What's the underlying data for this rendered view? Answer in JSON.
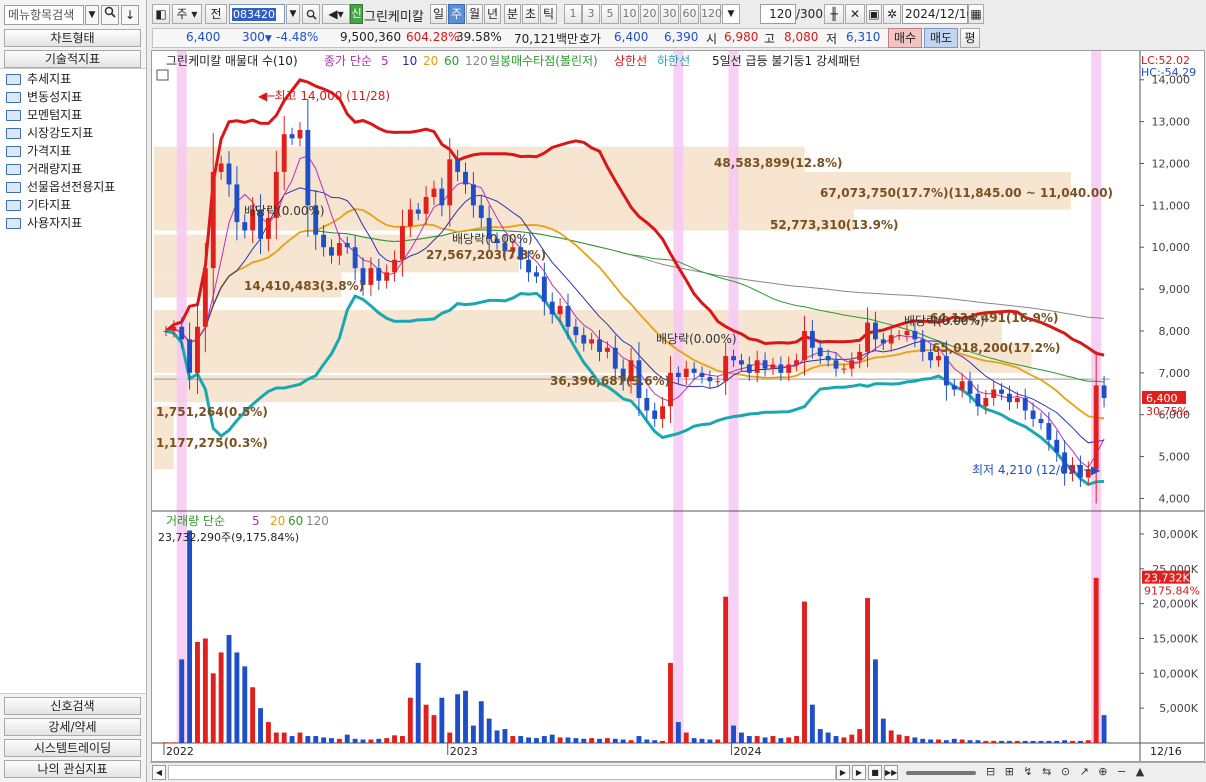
{
  "left_panel": {
    "menu_search_placeholder": "메뉴항목검색",
    "chart_type_label": "차트형태",
    "tech_indicator_label": "기술적지표",
    "tree": [
      "추세지표",
      "변동성지표",
      "모멘텀지표",
      "시장강도지표",
      "가격지표",
      "거래량지표",
      "선물옵션전용지표",
      "기타지표",
      "사용자지표"
    ],
    "bottom_buttons": [
      "신호검색",
      "강세/약세",
      "시스템트레이딩",
      "나의 관심지표"
    ]
  },
  "toolbar": {
    "period_select": "주",
    "prev_label": "전",
    "stock_code": "083420",
    "credit_badge": "신",
    "stock_name": "그린케미칼",
    "period_tabs": [
      "일",
      "주",
      "월",
      "년",
      "분",
      "초",
      "틱"
    ],
    "active_tab": "주",
    "interval_buttons": [
      "1",
      "3",
      "5",
      "10",
      "20",
      "30",
      "60",
      "120"
    ],
    "count_value": "120",
    "count_total": "/300",
    "date": "2024/12/16"
  },
  "quote": {
    "price": "6,400",
    "change": "300",
    "change_pct": "-4.48%",
    "volume": "9,500,360",
    "vol_ratio": "604.28%",
    "turnover": "39.58%",
    "amount": "70,121백만",
    "ask_label": "호가",
    "ask": "6,400",
    "bid": "6,390",
    "open_label": "시",
    "open": "6,980",
    "high_label": "고",
    "high": "8,080",
    "low_label": "저",
    "low": "6,310",
    "buy_label": "매수",
    "sell_label": "매도",
    "eval_label": "평"
  },
  "legend": {
    "title": "그린케미칼 매물대 수(10)",
    "ma_label": "종가 단순",
    "ma_periods": [
      "5",
      "10",
      "20",
      "60",
      "120"
    ],
    "ichimoku": "일봉매수타점(볼린저)",
    "upper": "상한선",
    "lower": "하한선",
    "pattern": "5일선 급등 불기둥1 강세패턴",
    "lc": "LC:52.02",
    "hc": "HC:-54.29"
  },
  "annotations": {
    "high_mark": "최고 14,000 (11/28)",
    "low_mark": "최저 4,210 (12/09)",
    "dividend": "배당락(0.00%)",
    "price_tag": "6,400",
    "price_pct": "30.75%",
    "vol_tag": "23,732K",
    "vol_pct": "9175.84%"
  },
  "profile_labels": [
    "48,583,899(12.8%)",
    "67,073,750(17.7%)(11,845.00 ~ 11,040.00)",
    "52,773,310(13.9%)",
    "27,567,203(7.3%)",
    "14,410,483(3.8%)",
    "64,134,491(16.9%)",
    "65,018,200(17.2%)",
    "36,396,687(9.6%)",
    "1,751,264(0.5%)",
    "1,177,275(0.3%)"
  ],
  "volume_legend": {
    "label": "거래량 단순",
    "periods": [
      "5",
      "20",
      "60",
      "120"
    ],
    "value": "23,732,290주(9,175.84%)"
  },
  "colors": {
    "up": "#e0201c",
    "down": "#1f4fc8",
    "bollinger_upper": "#d81818",
    "bollinger_lower": "#1aa8b0",
    "ma20": "#e8a014",
    "ma10": "#3030b0",
    "ma5": "#c02cc0",
    "profile": "#f6e4cf",
    "highlight": "#f7c8f5"
  },
  "chart_data": {
    "type": "candlestick",
    "price_axis": [
      "14,000",
      "13,000",
      "12,000",
      "11,000",
      "10,000",
      "9,000",
      "8,000",
      "7,000",
      "6,000",
      "5,000",
      "4,000"
    ],
    "ylim": [
      3700,
      14400
    ],
    "volume_axis": [
      "30,000K",
      "25,000K",
      "20,000K",
      "15,000K",
      "10,000K",
      "5,000K"
    ],
    "vol_ylim": [
      0,
      31000
    ],
    "x_labels": [
      "2022",
      "2023",
      "2024"
    ],
    "x_last": "12/16",
    "closes": [
      8000,
      8100,
      7800,
      7000,
      8100,
      9500,
      11800,
      12000,
      11500,
      10600,
      10400,
      10900,
      10200,
      10700,
      11800,
      12700,
      12600,
      12800,
      11000,
      10300,
      10000,
      9800,
      10100,
      10000,
      9500,
      9100,
      9500,
      9200,
      9400,
      9700,
      10500,
      10900,
      10800,
      11200,
      11400,
      11000,
      12100,
      11800,
      11500,
      11000,
      10700,
      10200,
      10100,
      9900,
      10000,
      9700,
      9400,
      9300,
      8700,
      8400,
      8600,
      8100,
      7900,
      7700,
      7800,
      7500,
      7600,
      7100,
      6800,
      7300,
      6400,
      6100,
      5900,
      6200,
      7000,
      6900,
      7100,
      7000,
      6900,
      6800,
      6800,
      7400,
      7300,
      7200,
      7000,
      7300,
      7100,
      7200,
      7000,
      7200,
      7300,
      8000,
      7600,
      7400,
      7300,
      7100,
      7100,
      7300,
      7500,
      8200,
      7800,
      7700,
      7900,
      7900,
      8000,
      7800,
      7500,
      7300,
      7400,
      6700,
      6600,
      6800,
      6500,
      6200,
      6400,
      6600,
      6500,
      6300,
      6400,
      6100,
      5900,
      5800,
      5400,
      5100,
      4600,
      4800,
      4500,
      4700,
      6700,
      6400
    ],
    "volumes": [
      0.1,
      0.1,
      12,
      30.5,
      14.5,
      15,
      10,
      13,
      15.5,
      13,
      11,
      8,
      5,
      3,
      1.5,
      1.5,
      1,
      1.5,
      1,
      1,
      0.8,
      0.7,
      0.6,
      1.2,
      0.6,
      0.5,
      0.5,
      0.6,
      0.7,
      1.1,
      1.0,
      6.5,
      11.5,
      5.5,
      4,
      6.5,
      1.5,
      7,
      7.5,
      2.5,
      6,
      3.5,
      1.8,
      2,
      1,
      1,
      0.8,
      0.7,
      1,
      1.2,
      0.8,
      0.8,
      0.7,
      0.6,
      0.7,
      0.6,
      0.7,
      0.6,
      0.5,
      0.4,
      1,
      0.5,
      0.4,
      0.3,
      11.5,
      3,
      1.5,
      0.7,
      0.6,
      0.5,
      0.5,
      21,
      2.5,
      1.5,
      1,
      1,
      0.8,
      1,
      0.7,
      0.8,
      1,
      20.3,
      5.5,
      2,
      1.5,
      1,
      0.8,
      1.2,
      2,
      20.8,
      12,
      3.5,
      1.8,
      1.2,
      1,
      0.8,
      0.6,
      0.5,
      0.5,
      0.4,
      0.6,
      0.5,
      0.4,
      0.4,
      0.3,
      0.3,
      0.3,
      0.3,
      0.3,
      0.3,
      0.3,
      0.3,
      0.3,
      0.3,
      0.4,
      0.3,
      0.3,
      0.4,
      23.7,
      4
    ]
  }
}
